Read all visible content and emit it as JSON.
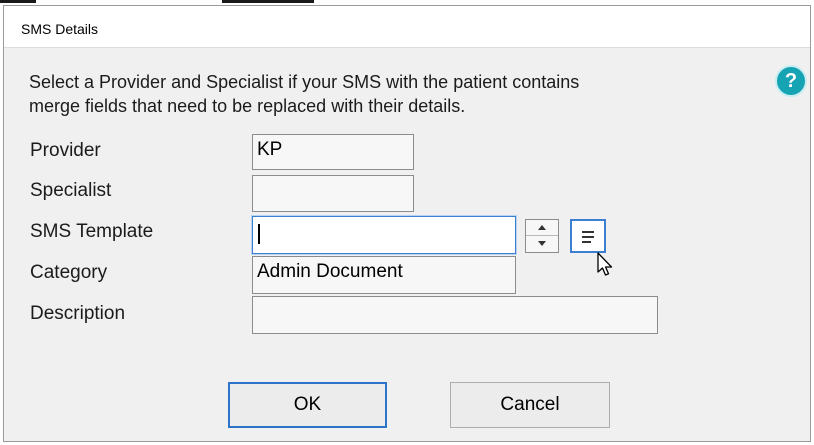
{
  "window": {
    "title": "SMS Details"
  },
  "instructions": {
    "line1": "Select a Provider and Specialist if your SMS with the patient contains",
    "line2": "merge fields that need to be replaced with their details."
  },
  "help": {
    "glyph": "?"
  },
  "fields": {
    "provider": {
      "label": "Provider",
      "value": "KP"
    },
    "specialist": {
      "label": "Specialist",
      "value": ""
    },
    "sms_template": {
      "label": "SMS Template",
      "value": ""
    },
    "category": {
      "label": "Category",
      "value": "Admin Document"
    },
    "description": {
      "label": "Description",
      "value": ""
    }
  },
  "buttons": {
    "ok": "OK",
    "cancel": "Cancel"
  },
  "icons": {
    "help": "help-icon",
    "spinner_up": "chevron-up-icon",
    "spinner_down": "chevron-down-icon",
    "template_list": "list-icon",
    "cursor": "mouse-pointer-icon"
  },
  "colors": {
    "help": "#16a3b3",
    "focus_border": "#3c7fd1",
    "default_button_border": "#2c73c9",
    "dialog_bg": "#f0f0f0"
  }
}
